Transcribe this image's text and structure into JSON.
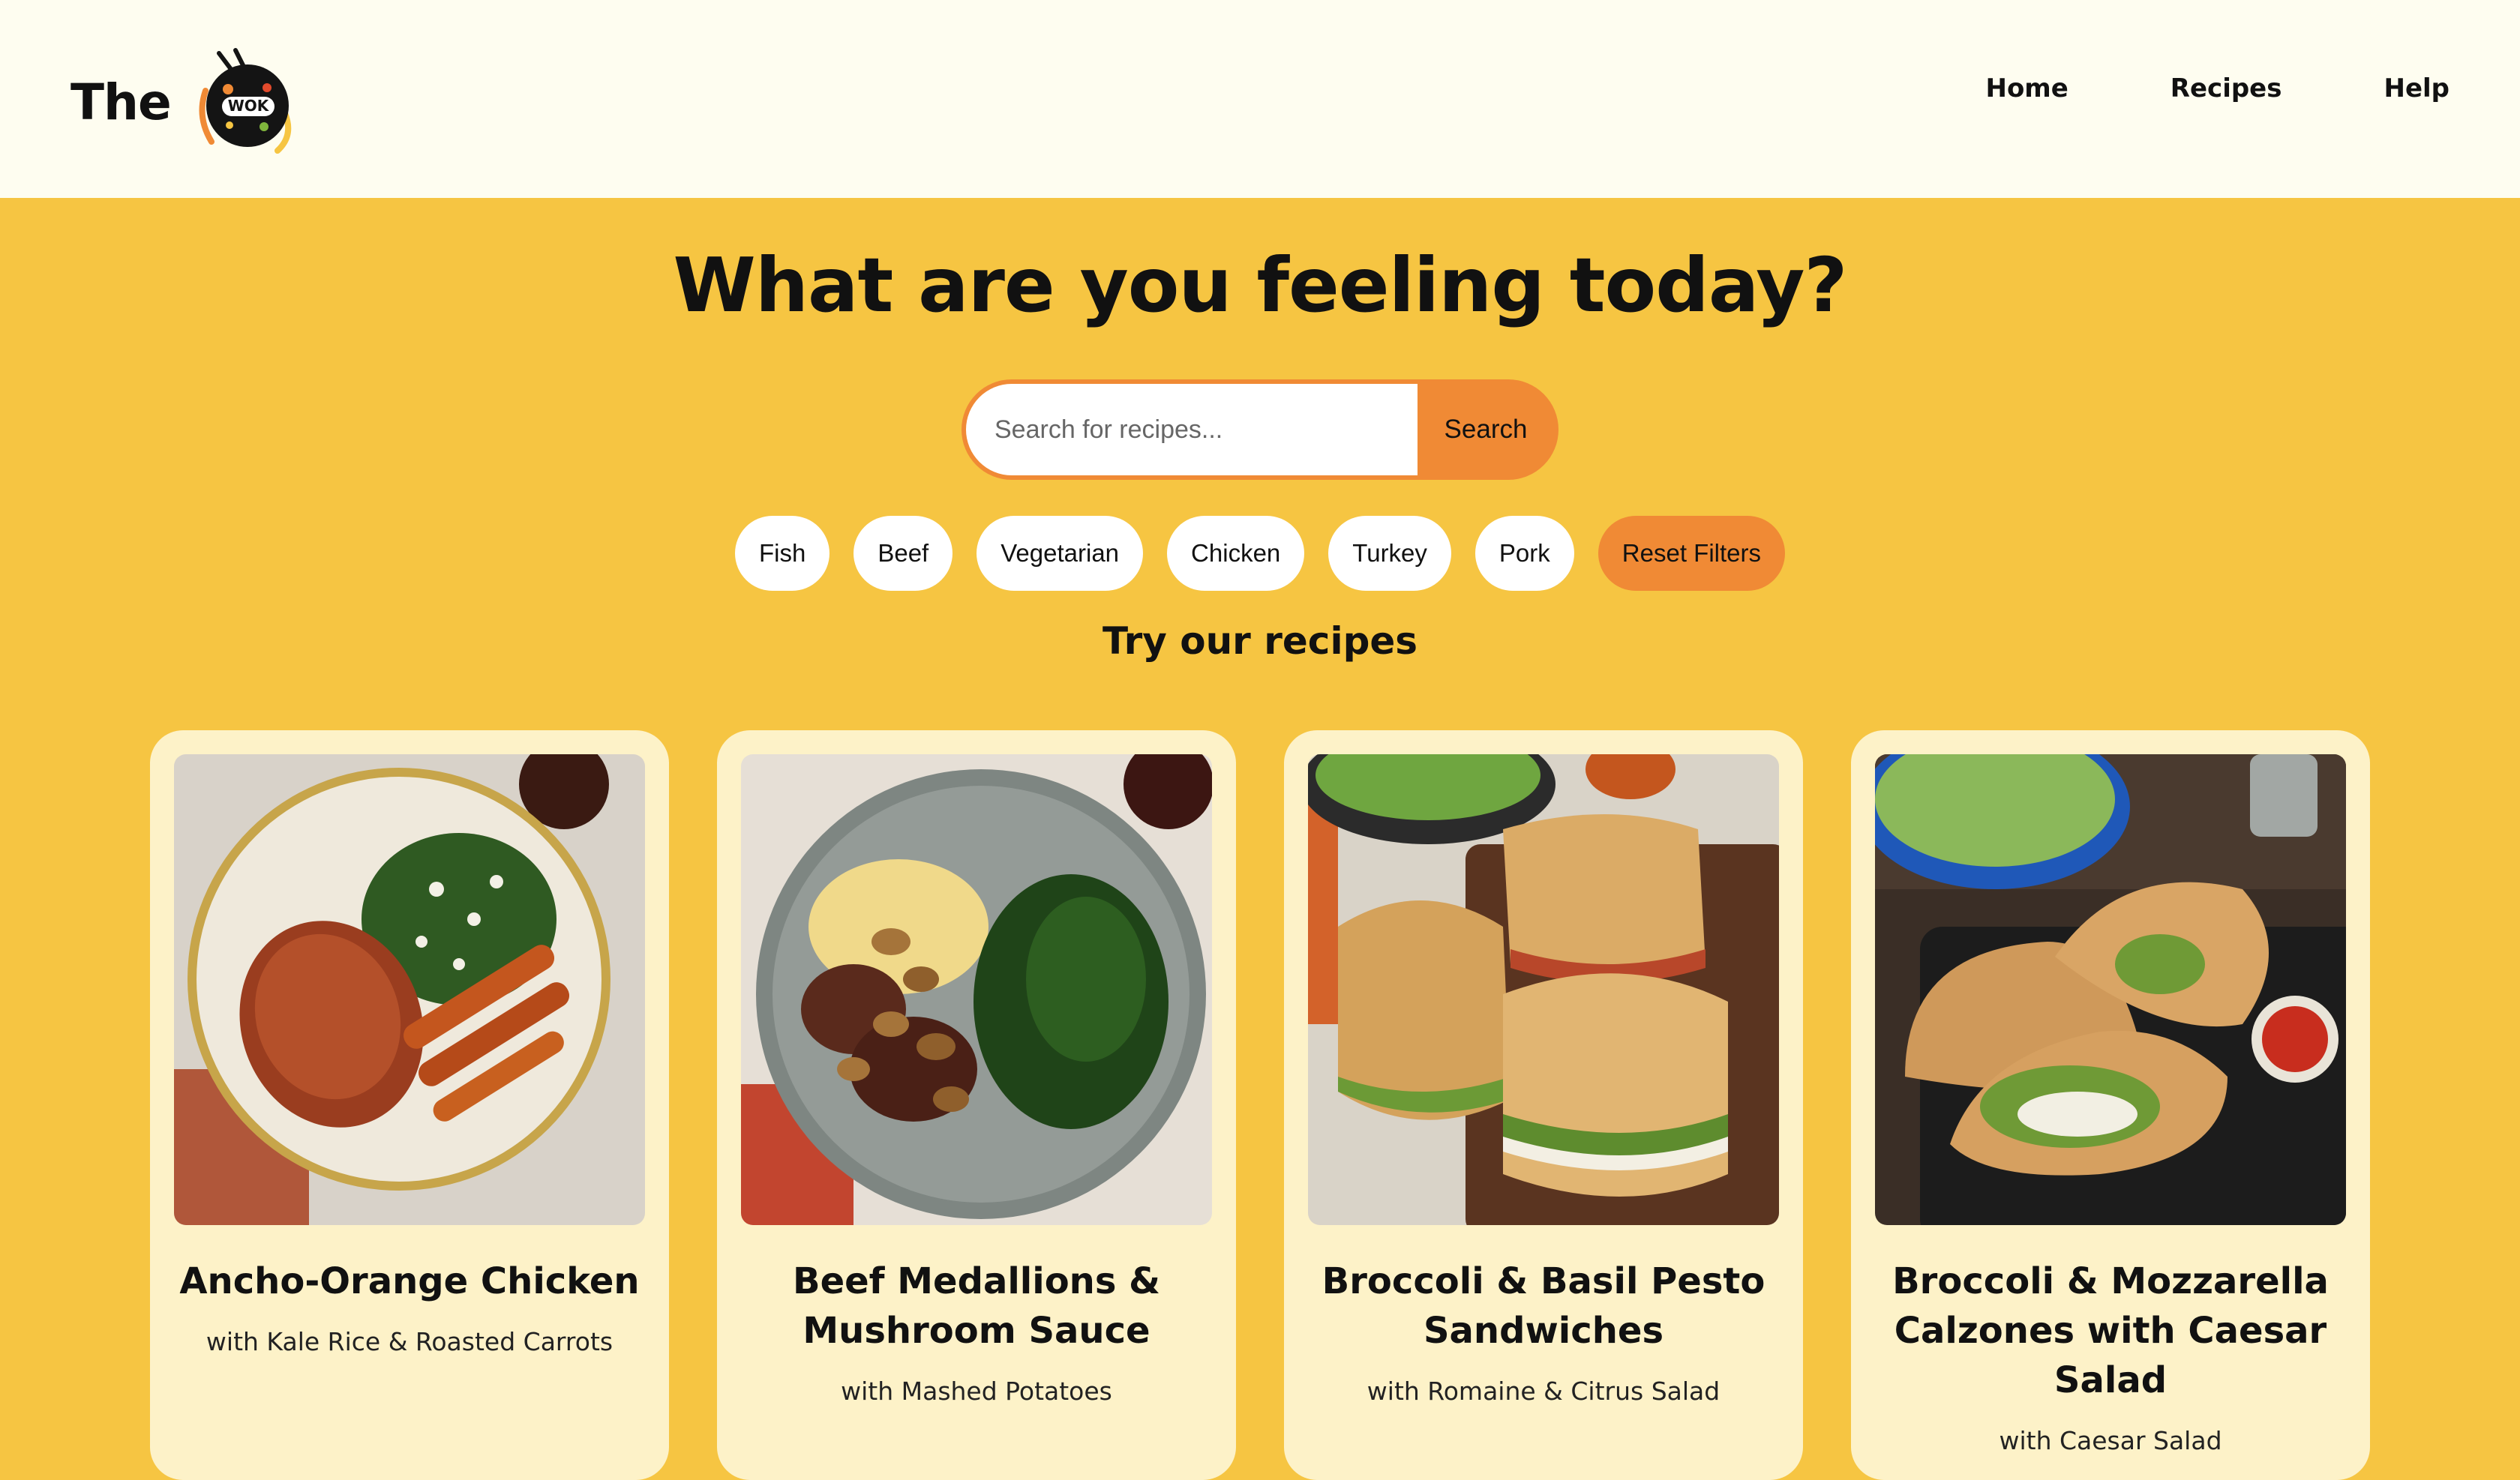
{
  "header": {
    "logo_text": "The",
    "logo_badge_text": "WOK",
    "nav": [
      {
        "label": "Home"
      },
      {
        "label": "Recipes"
      },
      {
        "label": "Help"
      }
    ]
  },
  "hero": {
    "title": "What are you feeling today?",
    "search": {
      "placeholder": "Search for recipes...",
      "value": "",
      "button_label": "Search"
    },
    "filters": [
      {
        "label": "Fish"
      },
      {
        "label": "Beef"
      },
      {
        "label": "Vegetarian"
      },
      {
        "label": "Chicken"
      },
      {
        "label": "Turkey"
      },
      {
        "label": "Pork"
      }
    ],
    "reset_label": "Reset Filters",
    "section_title": "Try our recipes"
  },
  "recipes": [
    {
      "title": "Ancho-Orange Chicken",
      "subtitle": "with Kale Rice & Roasted Carrots"
    },
    {
      "title": "Beef Medallions & Mushroom Sauce",
      "subtitle": "with Mashed Potatoes"
    },
    {
      "title": "Broccoli & Basil Pesto Sandwiches",
      "subtitle": "with Romaine & Citrus Salad"
    },
    {
      "title": "Broccoli & Mozzarella Calzones with Caesar Salad",
      "subtitle": "with Caesar Salad"
    }
  ],
  "colors": {
    "header_bg": "#fefdf0",
    "page_bg": "#f6c542",
    "accent": "#f08a35",
    "card_bg": "#fdf2c8"
  }
}
